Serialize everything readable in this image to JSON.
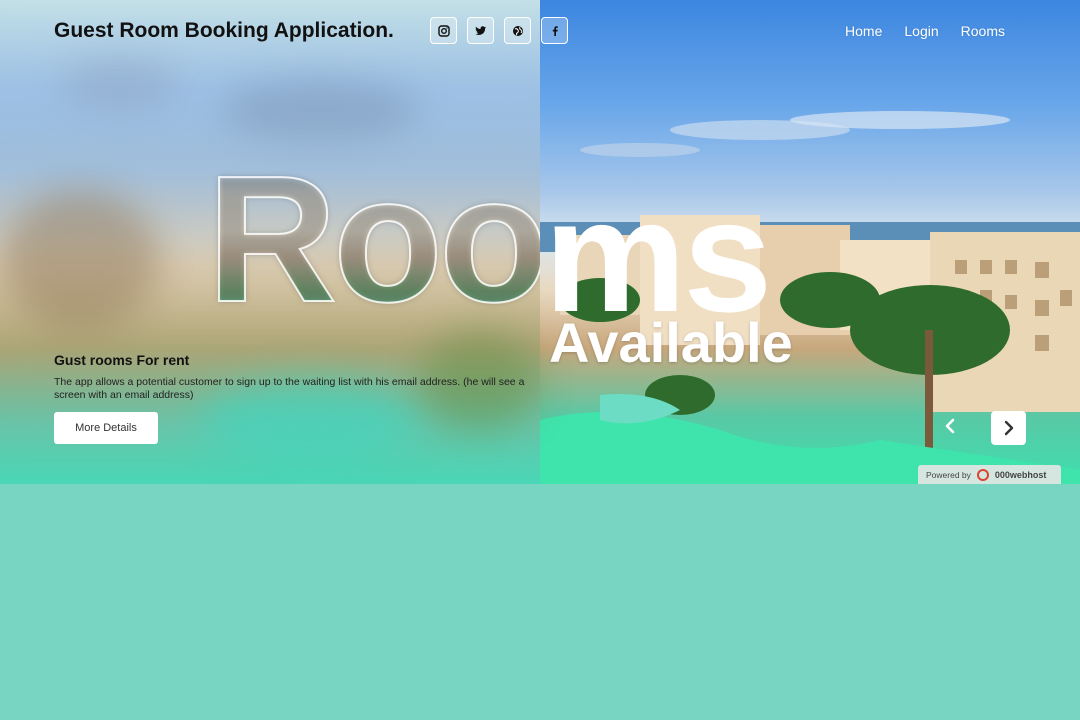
{
  "header": {
    "brand": "Guest Room Booking Application.",
    "socials": [
      {
        "icon": "instagram-icon"
      },
      {
        "icon": "twitter-icon"
      },
      {
        "icon": "globe-icon"
      },
      {
        "icon": "facebook-icon"
      }
    ],
    "nav": {
      "home": "Home",
      "login": "Login",
      "rooms": "Rooms"
    }
  },
  "hero": {
    "headline_left": "Roo",
    "headline_right": "ms",
    "subheadline": "Available",
    "info_title": "Gust rooms For rent",
    "info_description": "The app allows a potential customer to sign up to the waiting list with his email address. (he will see a screen with an email address)",
    "more_button": "More Details",
    "carousel": {
      "prev_icon": "chevron-left-icon",
      "next_icon": "chevron-right-icon"
    }
  },
  "footer_badge": {
    "prefix": "Powered by",
    "brand": "000webhost"
  },
  "colors": {
    "page_background": "#78d5c2",
    "accent_white": "#ffffff"
  }
}
